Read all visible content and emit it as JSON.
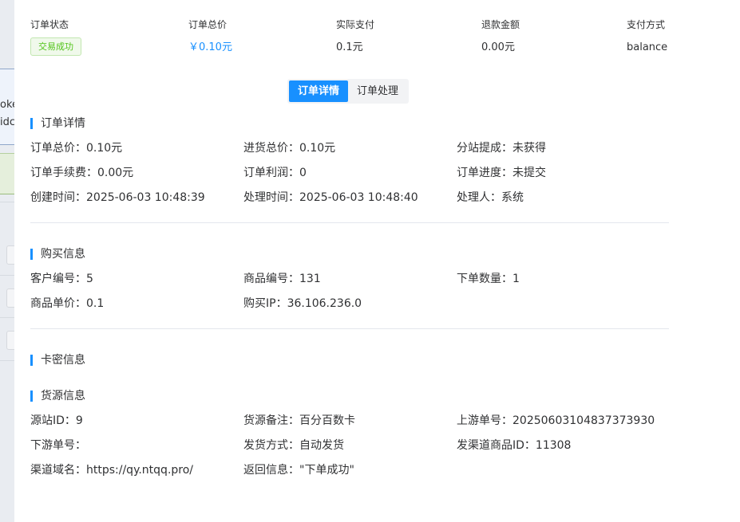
{
  "background": {
    "text_line_1": "oke",
    "text_line_2": "idc"
  },
  "summary": {
    "status_label": "订单状态",
    "status_badge": "交易成功",
    "total_label": "订单总价",
    "total_value": "￥0.10元",
    "paid_label": "实际支付",
    "paid_value": "0.1元",
    "refund_label": "退款金额",
    "refund_value": "0.00元",
    "method_label": "支付方式",
    "method_value": "balance"
  },
  "tabs": {
    "detail": "订单详情",
    "process": "订单处理",
    "active": "订单详情"
  },
  "order_detail": {
    "title": "订单详情",
    "rows": [
      [
        "订单总价：0.10元",
        "进货总价：0.10元",
        "分站提成：未获得"
      ],
      [
        "订单手续费：0.00元",
        "订单利润：0",
        "订单进度：未提交"
      ],
      [
        "创建时间：2025-06-03 10:48:39",
        "处理时间：2025-06-03 10:48:40",
        "处理人：系统"
      ]
    ]
  },
  "purchase_info": {
    "title": "购买信息",
    "rows": [
      [
        "客户编号：5",
        "商品编号：131",
        "下单数量：1"
      ],
      [
        "商品单价：0.1",
        "购买IP：36.106.236.0",
        ""
      ]
    ]
  },
  "card_info": {
    "title": "卡密信息"
  },
  "source_info": {
    "title": "货源信息",
    "rows": [
      [
        "源站ID：9",
        "货源备注：百分百数卡",
        "上游单号：20250603104837373930"
      ],
      [
        "下游单号：",
        "发货方式：自动发货",
        "发渠道商品ID：11308"
      ],
      [
        "渠道域名：https://qy.ntqq.pro/",
        "返回信息：\"下单成功\"",
        ""
      ]
    ]
  },
  "colors": {
    "accent": "#1890ff",
    "success": "#52c41a"
  }
}
